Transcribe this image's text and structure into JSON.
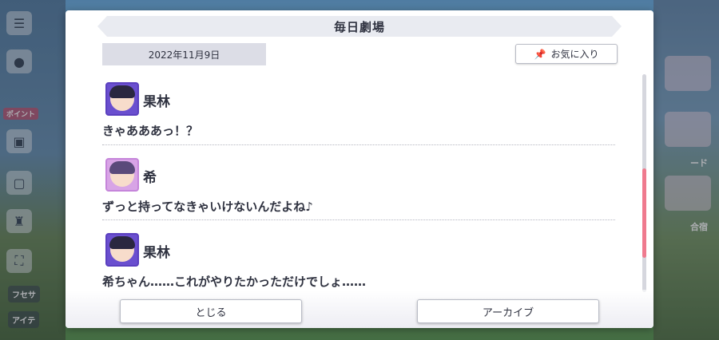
{
  "dialog": {
    "title": "毎日劇場",
    "date": "2022年11月9日",
    "favorite_label": "お気に入り"
  },
  "entries": [
    {
      "speaker": "果林",
      "avatar": "karin-avatar",
      "line": "きゃあああっ！？"
    },
    {
      "speaker": "希",
      "avatar": "nozomi-avatar",
      "line": "ずっと持ってなきゃいけないんだよね♪"
    },
    {
      "speaker": "果林",
      "avatar": "karin-avatar",
      "line": "希ちゃん……これがやりたかっただけでしょ……"
    }
  ],
  "footer": {
    "close_label": "とじる",
    "archive_label": "アーカイブ"
  },
  "background": {
    "left_tag": "ポイント",
    "left_label_1": "フセサ",
    "left_label_2": "アイテ",
    "right_label_1": "ード",
    "right_label_2": "合宿"
  },
  "colors": {
    "accent_scroll": "#ef7a8e",
    "avatar_purple": "#6a4fcf",
    "avatar_pink": "#d8a4e6"
  },
  "scroll_position": 0.45
}
